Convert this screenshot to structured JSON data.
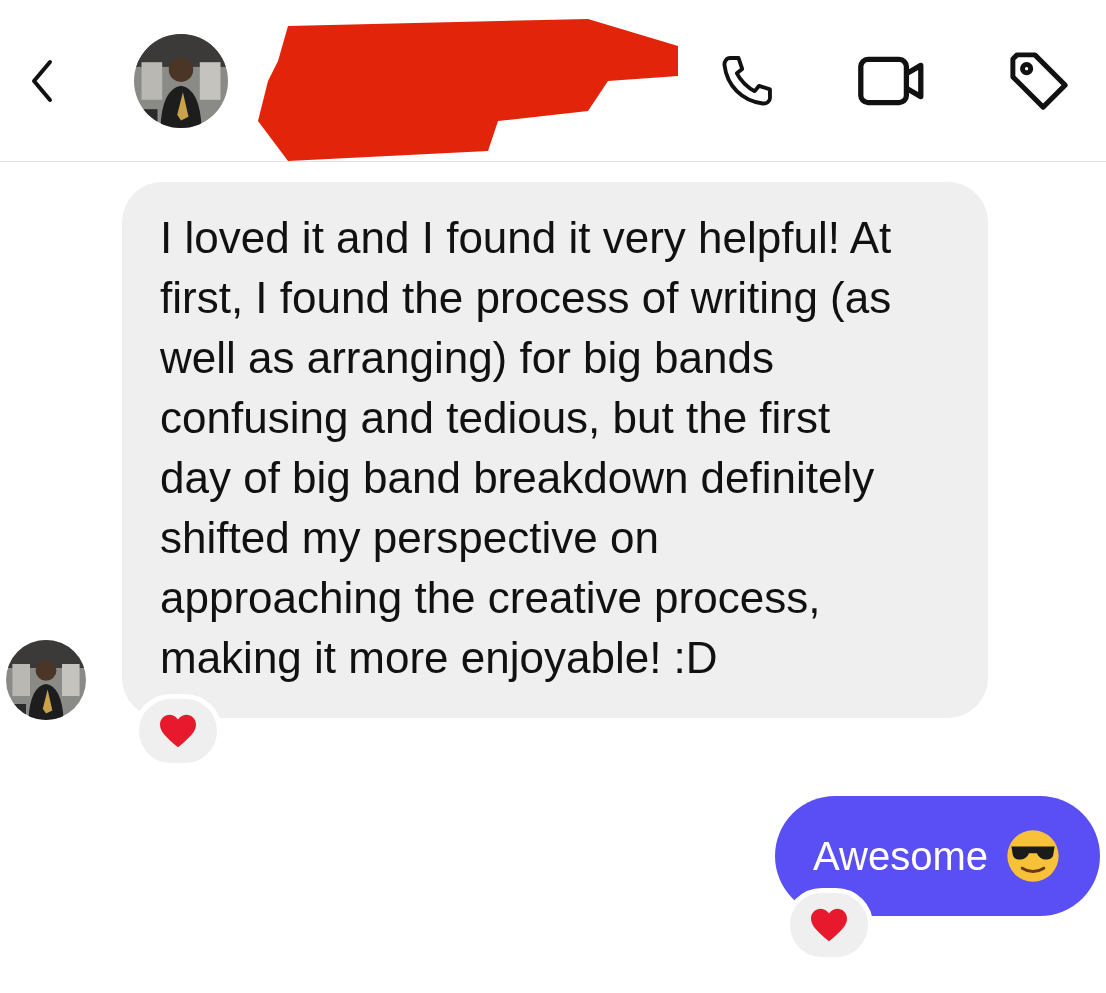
{
  "header": {
    "redacted": true
  },
  "messages": [
    {
      "kind": "received",
      "text": "I loved it and I found it very helpful! At first, I found the process of writing (as well as arranging) for big bands confusing and tedious, but the first day of big band breakdown definitely shifted my perspective on approaching the creative process, making it more enjoyable! :D",
      "hearted": true
    },
    {
      "kind": "sent",
      "text": "Awesome",
      "emoji": true,
      "hearted": true
    }
  ]
}
